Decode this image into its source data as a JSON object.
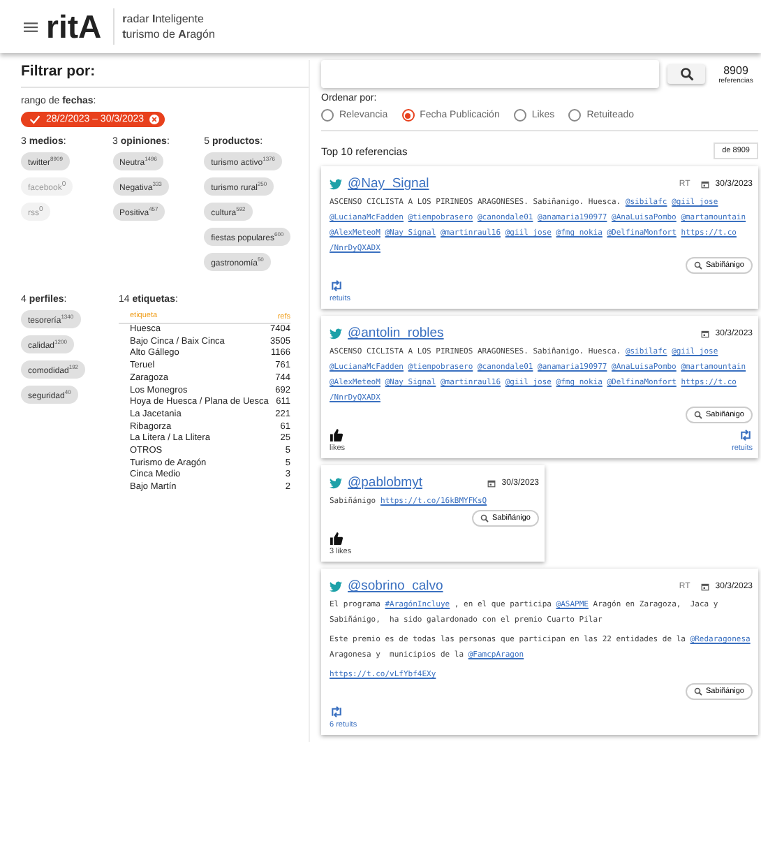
{
  "header": {
    "logo": "rit**A**",
    "tagline": [
      "**r**adar **I**nteligente",
      "**t**urismo de **A**ragón"
    ]
  },
  "filters": {
    "title": "Filtrar por:",
    "date_label": "rango de **fechas**:",
    "date_range": "28/2/2023 – 30/3/2023",
    "groups": [
      {
        "title": "3 **medios**:",
        "chips": [
          {
            "label": "twitter",
            "count": "8909",
            "disabled": false
          },
          {
            "label": "facebook",
            "count": "0",
            "disabled": true
          },
          {
            "label": "rss",
            "count": "0",
            "disabled": true
          }
        ]
      },
      {
        "title": "3 **opiniones**:",
        "chips": [
          {
            "label": "Neutra",
            "count": "1496",
            "disabled": false
          },
          {
            "label": "Negativa",
            "count": "333",
            "disabled": false
          },
          {
            "label": "Positiva",
            "count": "457",
            "disabled": false
          }
        ]
      },
      {
        "title": "5 **productos**:",
        "chips": [
          {
            "label": "turismo activo",
            "count": "1376",
            "disabled": false
          },
          {
            "label": "turismo rural",
            "count": "250",
            "disabled": false
          },
          {
            "label": "cultura",
            "count": "592",
            "disabled": false
          },
          {
            "label": "fiestas populares",
            "count": "600",
            "disabled": false
          },
          {
            "label": "gastronomía",
            "count": "50",
            "disabled": false
          }
        ]
      }
    ],
    "profiles": {
      "title": "4 **perfiles**:",
      "chips": [
        {
          "label": "tesorería",
          "count": "1340",
          "disabled": false
        },
        {
          "label": "calidad",
          "count": "1200",
          "disabled": false
        },
        {
          "label": "comodidad",
          "count": "192",
          "disabled": false
        },
        {
          "label": "seguridad",
          "count": "40",
          "disabled": false
        }
      ]
    },
    "tags": {
      "title": "14 **etiquetas**:",
      "columns": [
        "etiqueta",
        "refs"
      ],
      "rows": [
        [
          "Huesca",
          "7404"
        ],
        [
          "Bajo Cinca / Baix Cinca",
          "3505"
        ],
        [
          "Alto Gállego",
          "1166"
        ],
        [
          "Teruel",
          "761"
        ],
        [
          "Zaragoza",
          "744"
        ],
        [
          "Los Monegros",
          "692"
        ],
        [
          "Hoya de Huesca / Plana de Uesca",
          "611"
        ],
        [
          "La Jacetania",
          "221"
        ],
        [
          "Ribagorza",
          "61"
        ],
        [
          "La Litera / La Llitera",
          "25"
        ],
        [
          "OTROS",
          "5"
        ],
        [
          "Turismo de Aragón",
          "5"
        ],
        [
          "Cinca Medio",
          "3"
        ],
        [
          "Bajo Martín",
          "2"
        ]
      ]
    }
  },
  "search": {
    "count": "8909",
    "count_label": "referencias"
  },
  "sort": {
    "label": "Ordenar por:",
    "options": [
      {
        "label": "Relevancia",
        "selected": false
      },
      {
        "label": "Fecha Publicación",
        "selected": true
      },
      {
        "label": "Likes",
        "selected": false
      },
      {
        "label": "Retuiteado",
        "selected": false
      }
    ]
  },
  "results": {
    "title": "Top 10 referencias",
    "of": "de 8909"
  },
  "tweets": [
    {
      "handle": "@Nay_Signal",
      "rt": "RT",
      "date": "30/3/2023",
      "narrow": false,
      "body": [
        [
          {
            "text": "ASCENSO CICLISTA A LOS PIRINEOS ARAGONESES. Sabiñanigo. Huesca."
          },
          {
            "links": [
              "@sibilafc",
              "@giil_jose",
              "@LucianaMcFadden",
              "@tiempobrasero",
              "@canondale01",
              "@anamaria190977",
              "@AnaLuisaPombo",
              "@martamountain",
              "@AlexMeteoM",
              "@Nay_Signal",
              "@martinraul16",
              "@giil_jose",
              "@fmg_nokia",
              "@DelfinaMonfort",
              "https://t.co",
              "/NnrDyQXADX"
            ]
          }
        ]
      ],
      "tag": "Sabiñánigo",
      "actions": [
        {
          "kind": "retuits",
          "label": "retuits"
        }
      ]
    },
    {
      "handle": "@antolin_robles",
      "date": "30/3/2023",
      "narrow": false,
      "body": [
        [
          {
            "text": "ASCENSO CICLISTA A LOS PIRINEOS ARAGONESES. Sabiñanigo. Huesca."
          },
          {
            "links": [
              "@sibilafc",
              "@giil_jose",
              "@LucianaMcFadden",
              "@tiempobrasero",
              "@canondale01",
              "@anamaria190977",
              "@AnaLuisaPombo",
              "@martamountain",
              "@AlexMeteoM",
              "@Nay_Signal",
              "@martinraul16",
              "@giil_jose",
              "@fmg_nokia",
              "@DelfinaMonfort",
              "https://t.co",
              "/NnrDyQXADX"
            ]
          }
        ]
      ],
      "tag": "Sabiñánigo",
      "actions": [
        {
          "kind": "likes",
          "label": "likes"
        },
        {
          "kind": "retuits",
          "label": "retuits"
        }
      ]
    },
    {
      "handle": "@pablobmyt",
      "date": "30/3/2023",
      "narrow": true,
      "body": [
        [
          {
            "text": "Sabiñánigo"
          },
          {
            "links": [
              "https://t.co/16kBMYFKsQ"
            ]
          }
        ]
      ],
      "tag": "Sabiñánigo",
      "actions": [
        {
          "kind": "likes",
          "label": "3 likes"
        }
      ]
    },
    {
      "handle": "@sobrino_calvo",
      "rt": "RT",
      "date": "30/3/2023",
      "narrow": false,
      "body": [
        [
          {
            "text": "El programa"
          },
          {
            "links": [
              "#AragónIncluye"
            ]
          },
          {
            "text": ", en el que participa"
          },
          {
            "links": [
              "@ASAPME"
            ]
          },
          {
            "text": "Aragón en Zaragoza,  Jaca y Sabiñánigo,  ha sido galardonado con el premio Cuarto Pilar"
          }
        ],
        [
          {
            "text": "Este premio es de todas las personas que participan en las 22 entidades de la"
          },
          {
            "links": [
              "@Redaragonesa"
            ]
          },
          {
            "text": "Aragonesa y  municipios de la"
          },
          {
            "links": [
              "@FamcpAragon"
            ]
          }
        ],
        [
          {
            "links": [
              "https://t.co/vLfYbf4EXy"
            ]
          }
        ]
      ],
      "tag": "Sabiñánigo",
      "actions": [
        {
          "kind": "retuits",
          "label": "6 retuits"
        }
      ]
    }
  ]
}
